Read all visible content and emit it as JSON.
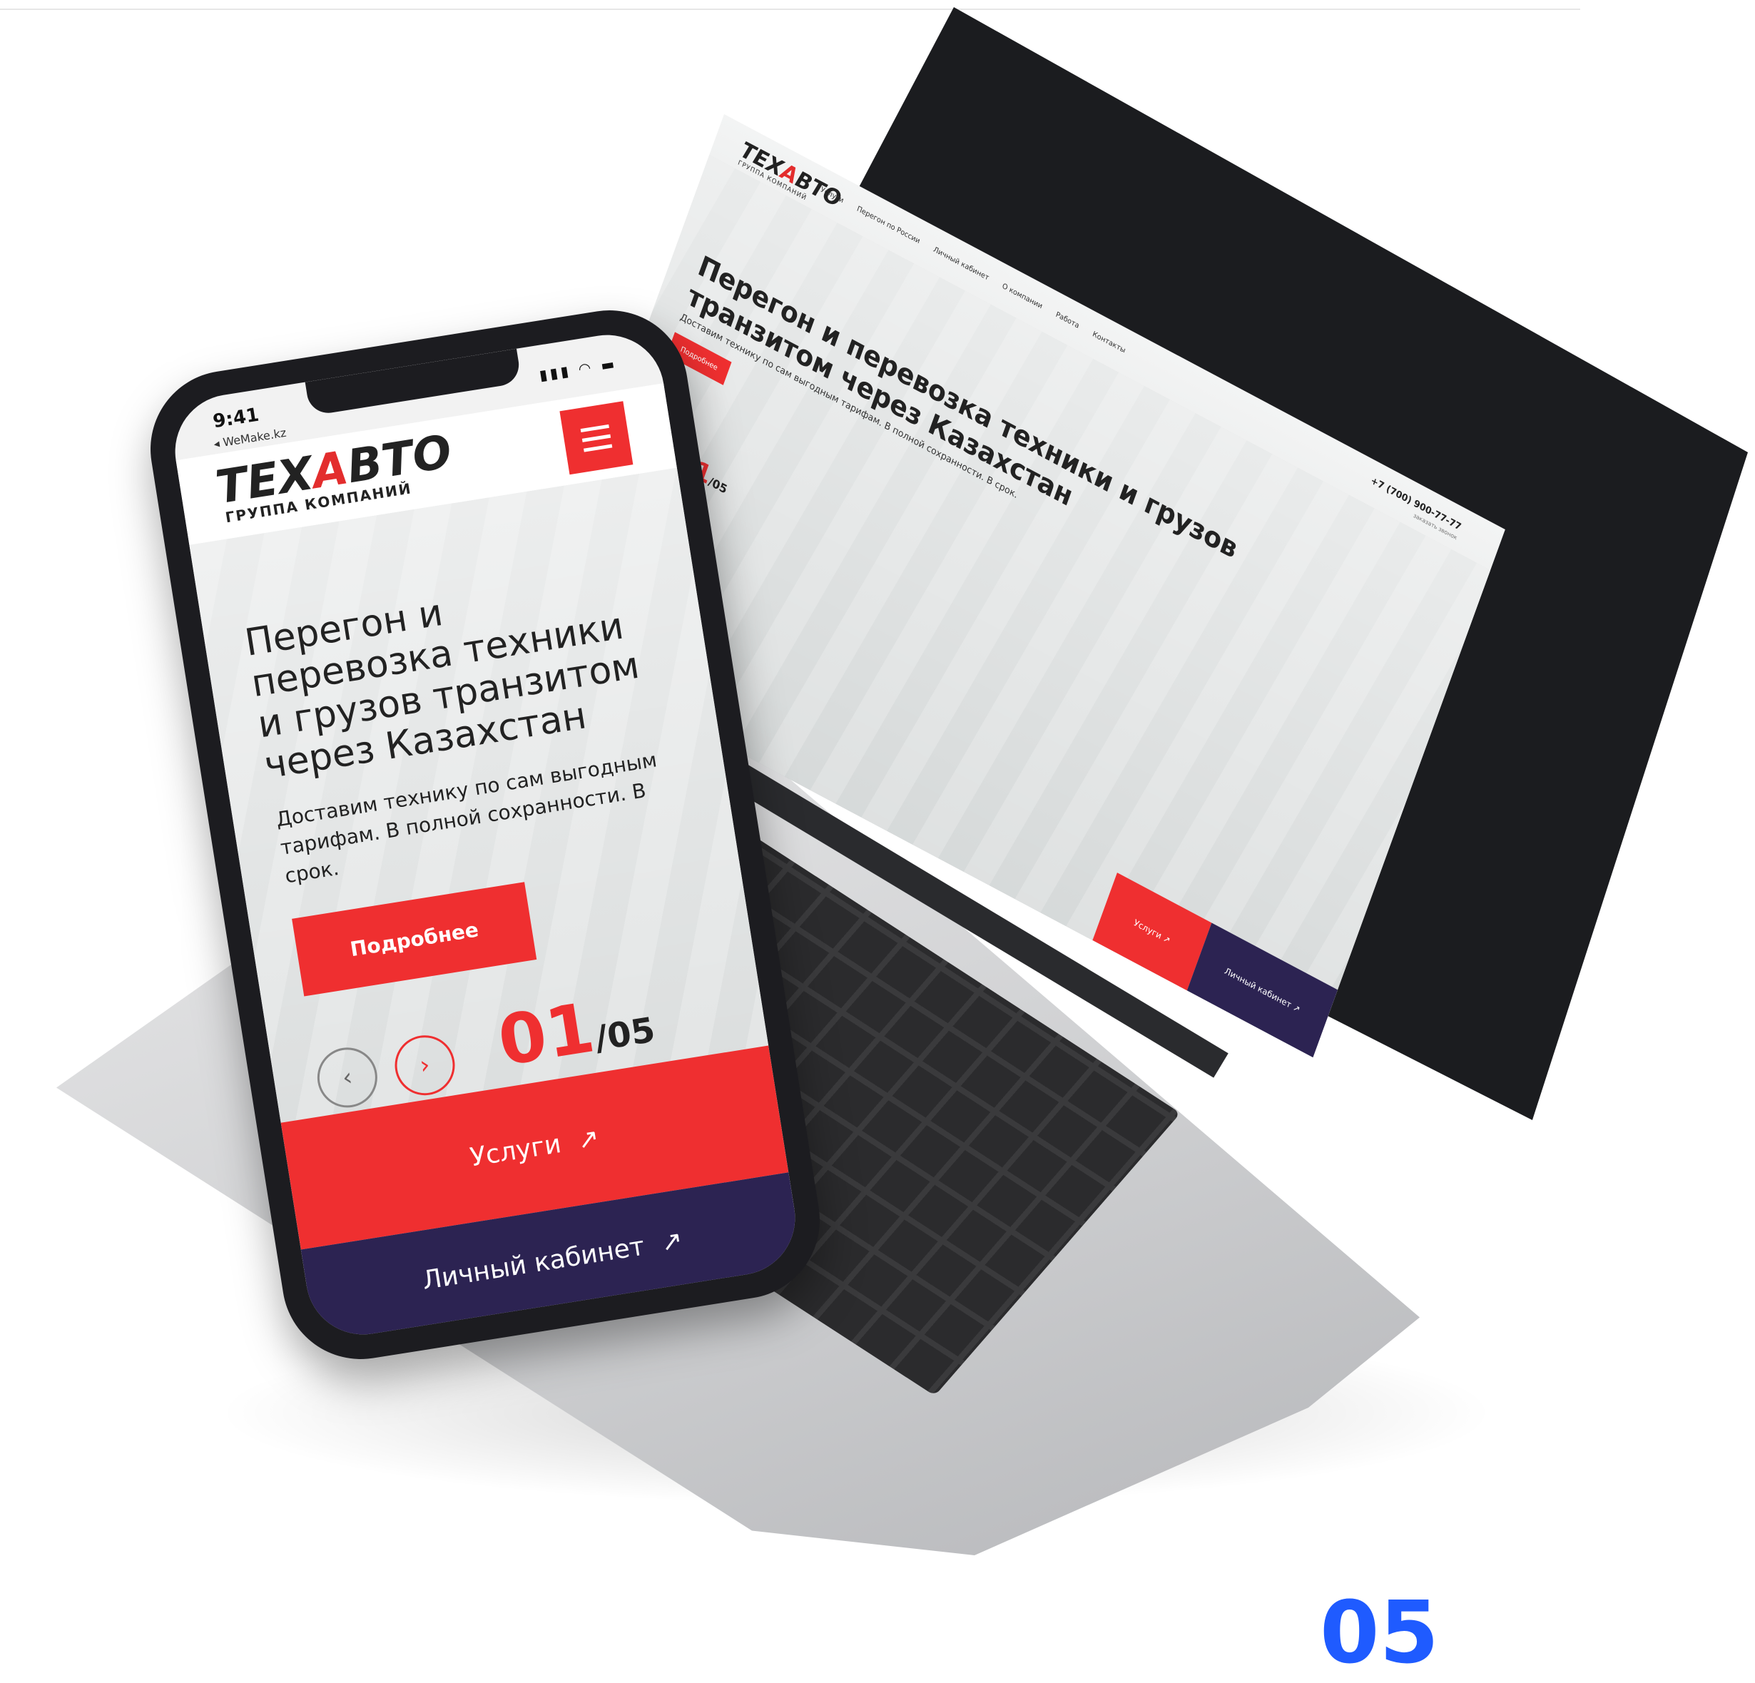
{
  "brand": {
    "name_black": "ТЕХ",
    "name_red": "А",
    "name_black2": "ВТО",
    "subtitle": "ГРУППА КОМПАНИЙ"
  },
  "laptop": {
    "nav": [
      "Услуги",
      "Перегон по России",
      "Личный кабинет",
      "О компании",
      "Работа",
      "Контакты"
    ],
    "phone": "+7 (700) 900-77-77",
    "call_label": "заказать звонок",
    "title": "Перегон и перевозка техники и грузов транзитом через Казахстан",
    "subtitle": "Доставим технику по сам выгодным тарифам. В полной сохранности. В срок.",
    "cta": "Подробнее",
    "prev_icon": "‹",
    "next_icon": "›",
    "counter_current": "01",
    "counter_total": "/05",
    "services": "Услуги ↗",
    "cabinet": "Личный кабинет ↗"
  },
  "phone": {
    "time": "9:41",
    "url": "◂ WeMake.kz",
    "title": "Перегон и перевозка техники и грузов транзитом через Казахстан",
    "description": "Доставим технику по сам выгодным тарифам. В полной сохранности. В срок.",
    "cta": "Подробнее",
    "prev_icon": "‹",
    "next_icon": "›",
    "counter_current": "01",
    "counter_total": "/05",
    "services": "Услуги",
    "cabinet": "Личный кабинет",
    "arrow": "↗"
  },
  "corner_text": "05",
  "colors": {
    "accent": "#ef2f30",
    "dark": "#2c2352"
  }
}
